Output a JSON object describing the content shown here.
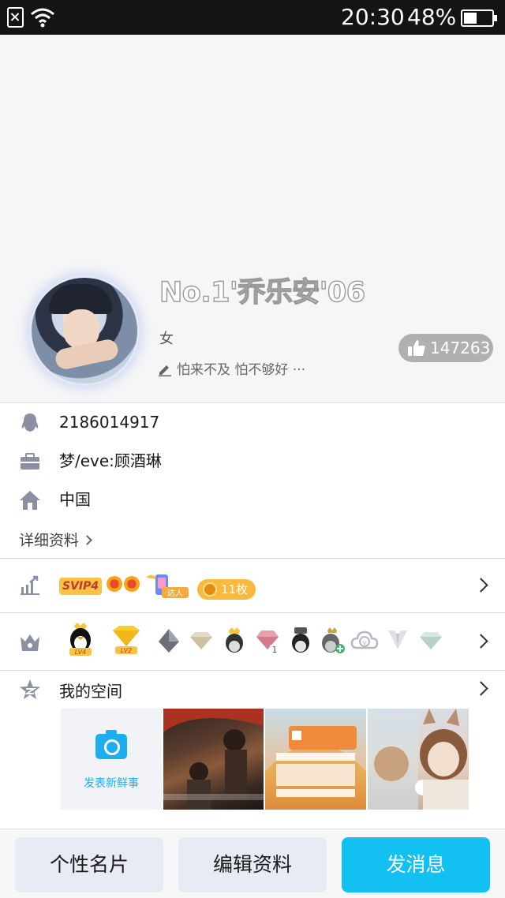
{
  "status_bar": {
    "time": "20:30",
    "battery_percent": "48%",
    "battery_level": 0.48
  },
  "profile": {
    "nickname": "No.1'乔乐安'06",
    "gender": "女",
    "signature": "怕来不及 怕不够好 ···",
    "likes": "147263"
  },
  "info": {
    "qq_number": "2186014917",
    "company": "梦/eve:顾酒琳",
    "location": "中国",
    "detail_link": "详细资料"
  },
  "vip": {
    "svip_label": "SVIP4",
    "talent_label": "达人",
    "medal_count": "11枚"
  },
  "badges": [
    "lv4-penguin",
    "lv2-diamond",
    "dark-gem",
    "light-diamond",
    "crown-penguin",
    "pink-gem",
    "hat-penguin",
    "plus-penguin",
    "v-cloud",
    "tie",
    "crystal-diamond"
  ],
  "space": {
    "title": "我的空间",
    "post_label": "发表新鲜事"
  },
  "bottom_bar": {
    "card_label": "个性名片",
    "edit_label": "编辑资料",
    "message_label": "发消息"
  },
  "colors": {
    "accent": "#12c1f2",
    "svip": "#f7c342",
    "medal": "#f9b93e"
  }
}
